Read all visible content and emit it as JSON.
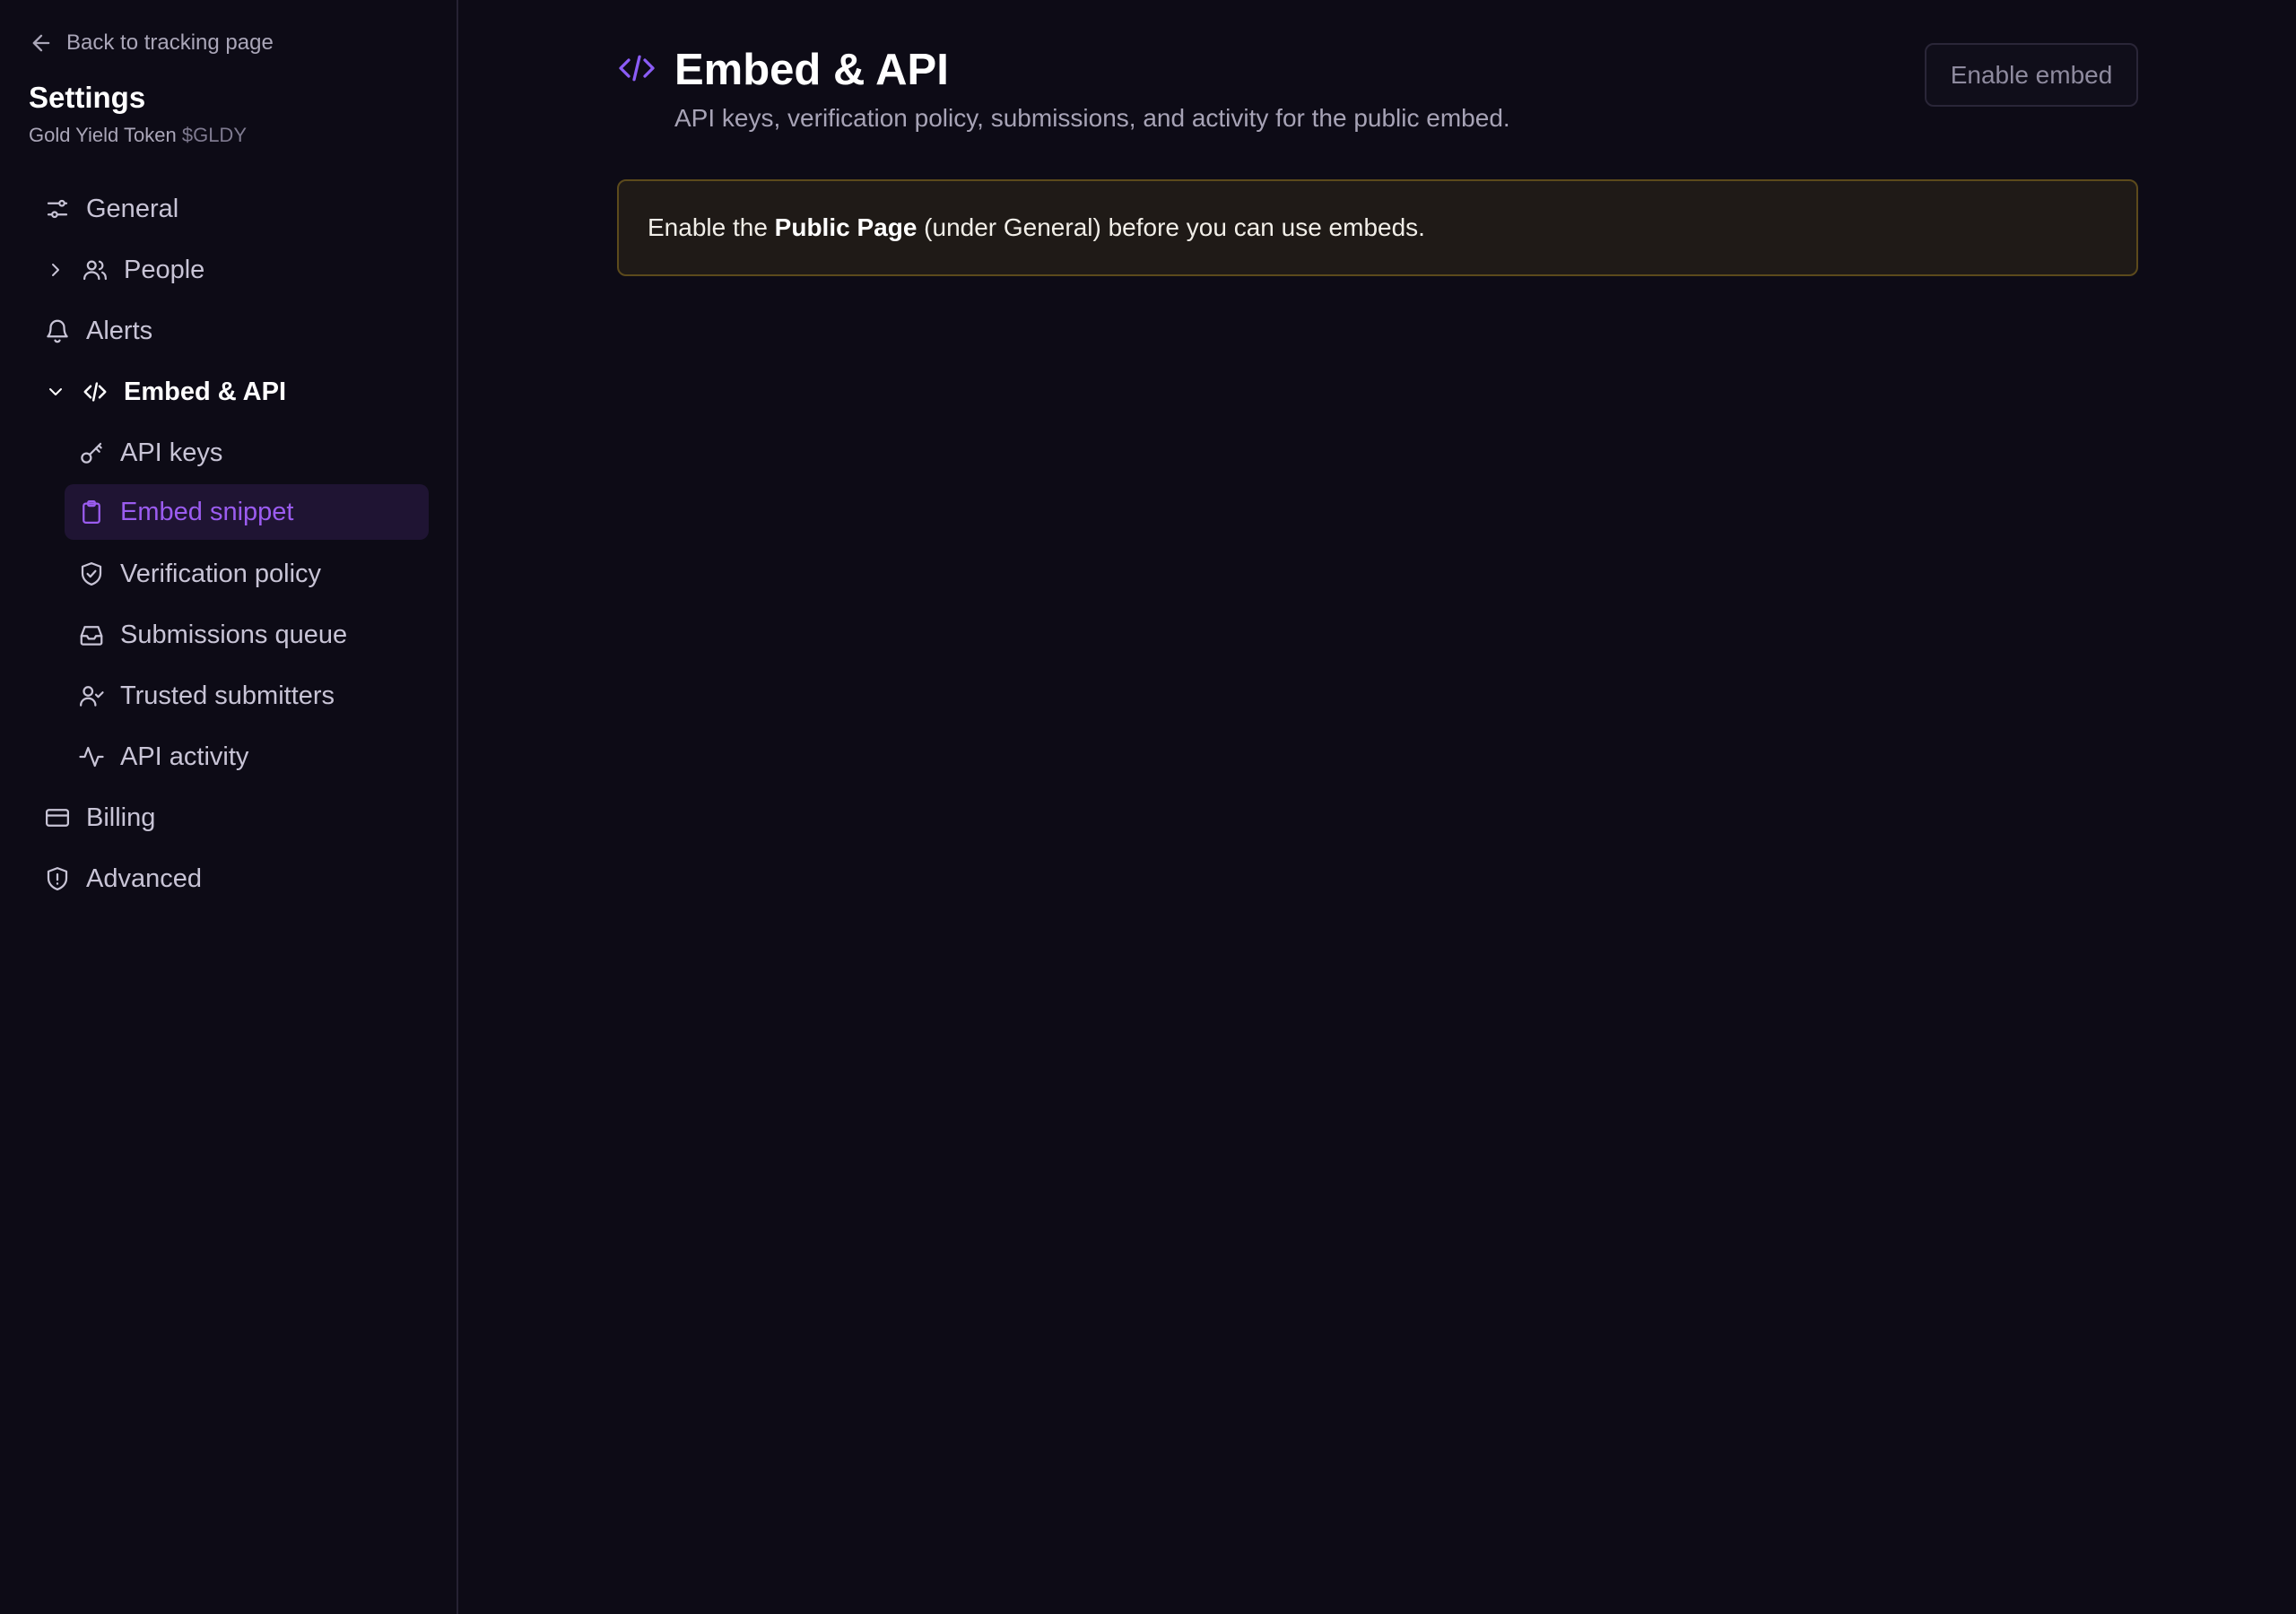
{
  "sidebar": {
    "back_label": "Back to tracking page",
    "title": "Settings",
    "project_name": "Gold Yield Token",
    "project_ticker": "$GLDY",
    "items": [
      {
        "label": "General",
        "icon": "sliders-icon"
      },
      {
        "label": "People",
        "icon": "users-icon",
        "expandable": true,
        "expanded": false
      },
      {
        "label": "Alerts",
        "icon": "bell-icon"
      },
      {
        "label": "Embed & API",
        "icon": "code-icon",
        "expandable": true,
        "expanded": true,
        "children": [
          {
            "label": "API keys",
            "icon": "key-icon"
          },
          {
            "label": "Embed snippet",
            "icon": "clipboard-icon",
            "active": true
          },
          {
            "label": "Verification policy",
            "icon": "shield-check-icon"
          },
          {
            "label": "Submissions queue",
            "icon": "inbox-icon"
          },
          {
            "label": "Trusted submitters",
            "icon": "user-check-icon"
          },
          {
            "label": "API activity",
            "icon": "activity-icon"
          }
        ]
      },
      {
        "label": "Billing",
        "icon": "credit-card-icon"
      },
      {
        "label": "Advanced",
        "icon": "shield-alert-icon"
      }
    ]
  },
  "main": {
    "title": "Embed & API",
    "subtitle": "API keys, verification policy, submissions, and activity for the public embed.",
    "enable_button": "Enable embed",
    "notice": {
      "prefix": "Enable the ",
      "bold": "Public Page",
      "suffix": " (under General) before you can use embeds."
    }
  },
  "colors": {
    "background": "#0d0b16",
    "accent": "#8b5cf6",
    "active_bg": "#1f1433",
    "notice_border": "#5c4a1c",
    "notice_bg": "#1f1a17"
  }
}
